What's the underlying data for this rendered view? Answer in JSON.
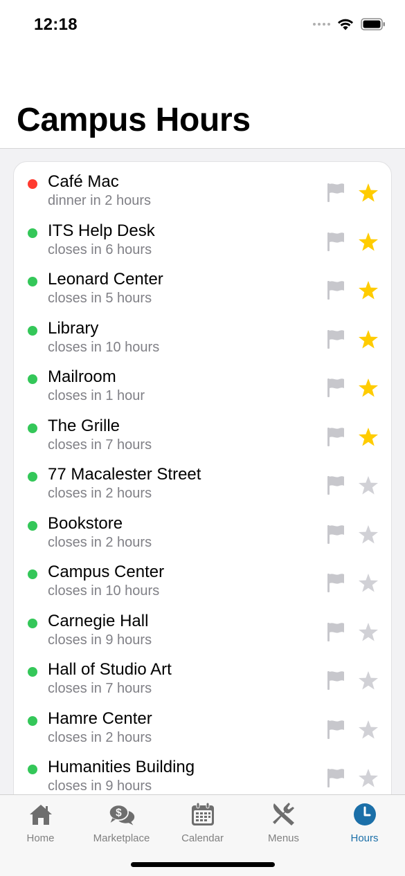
{
  "status_bar": {
    "time": "12:18"
  },
  "header": {
    "title": "Campus Hours"
  },
  "colors": {
    "open": "#34c759",
    "closed": "#ff3b30",
    "star_active": "#ffcc00",
    "star_inactive": "#d1d1d6",
    "flag": "#c7c7cc",
    "tab_active": "#1b6fa8",
    "tab_inactive": "#808080"
  },
  "locations": [
    {
      "name": "Café Mac",
      "status": "dinner in 2 hours",
      "state": "closed",
      "favorite": true
    },
    {
      "name": "ITS Help Desk",
      "status": "closes in 6 hours",
      "state": "open",
      "favorite": true
    },
    {
      "name": "Leonard Center",
      "status": "closes in 5 hours",
      "state": "open",
      "favorite": true
    },
    {
      "name": "Library",
      "status": "closes in 10 hours",
      "state": "open",
      "favorite": true
    },
    {
      "name": "Mailroom",
      "status": "closes in 1 hour",
      "state": "open",
      "favorite": true
    },
    {
      "name": "The Grille",
      "status": "closes in 7 hours",
      "state": "open",
      "favorite": true
    },
    {
      "name": "77 Macalester Street",
      "status": "closes in 2 hours",
      "state": "open",
      "favorite": false
    },
    {
      "name": "Bookstore",
      "status": "closes in 2 hours",
      "state": "open",
      "favorite": false
    },
    {
      "name": "Campus Center",
      "status": "closes in 10 hours",
      "state": "open",
      "favorite": false
    },
    {
      "name": "Carnegie Hall",
      "status": "closes in 9 hours",
      "state": "open",
      "favorite": false
    },
    {
      "name": "Hall of Studio Art",
      "status": "closes in 7 hours",
      "state": "open",
      "favorite": false
    },
    {
      "name": "Hamre Center",
      "status": "closes in 2 hours",
      "state": "open",
      "favorite": false
    },
    {
      "name": "Humanities Building",
      "status": "closes in 9 hours",
      "state": "open",
      "favorite": false
    }
  ],
  "tabs": [
    {
      "label": "Home",
      "icon": "home-icon",
      "active": false
    },
    {
      "label": "Marketplace",
      "icon": "marketplace-icon",
      "active": false
    },
    {
      "label": "Calendar",
      "icon": "calendar-icon",
      "active": false
    },
    {
      "label": "Menus",
      "icon": "menus-icon",
      "active": false
    },
    {
      "label": "Hours",
      "icon": "clock-icon",
      "active": true
    }
  ]
}
